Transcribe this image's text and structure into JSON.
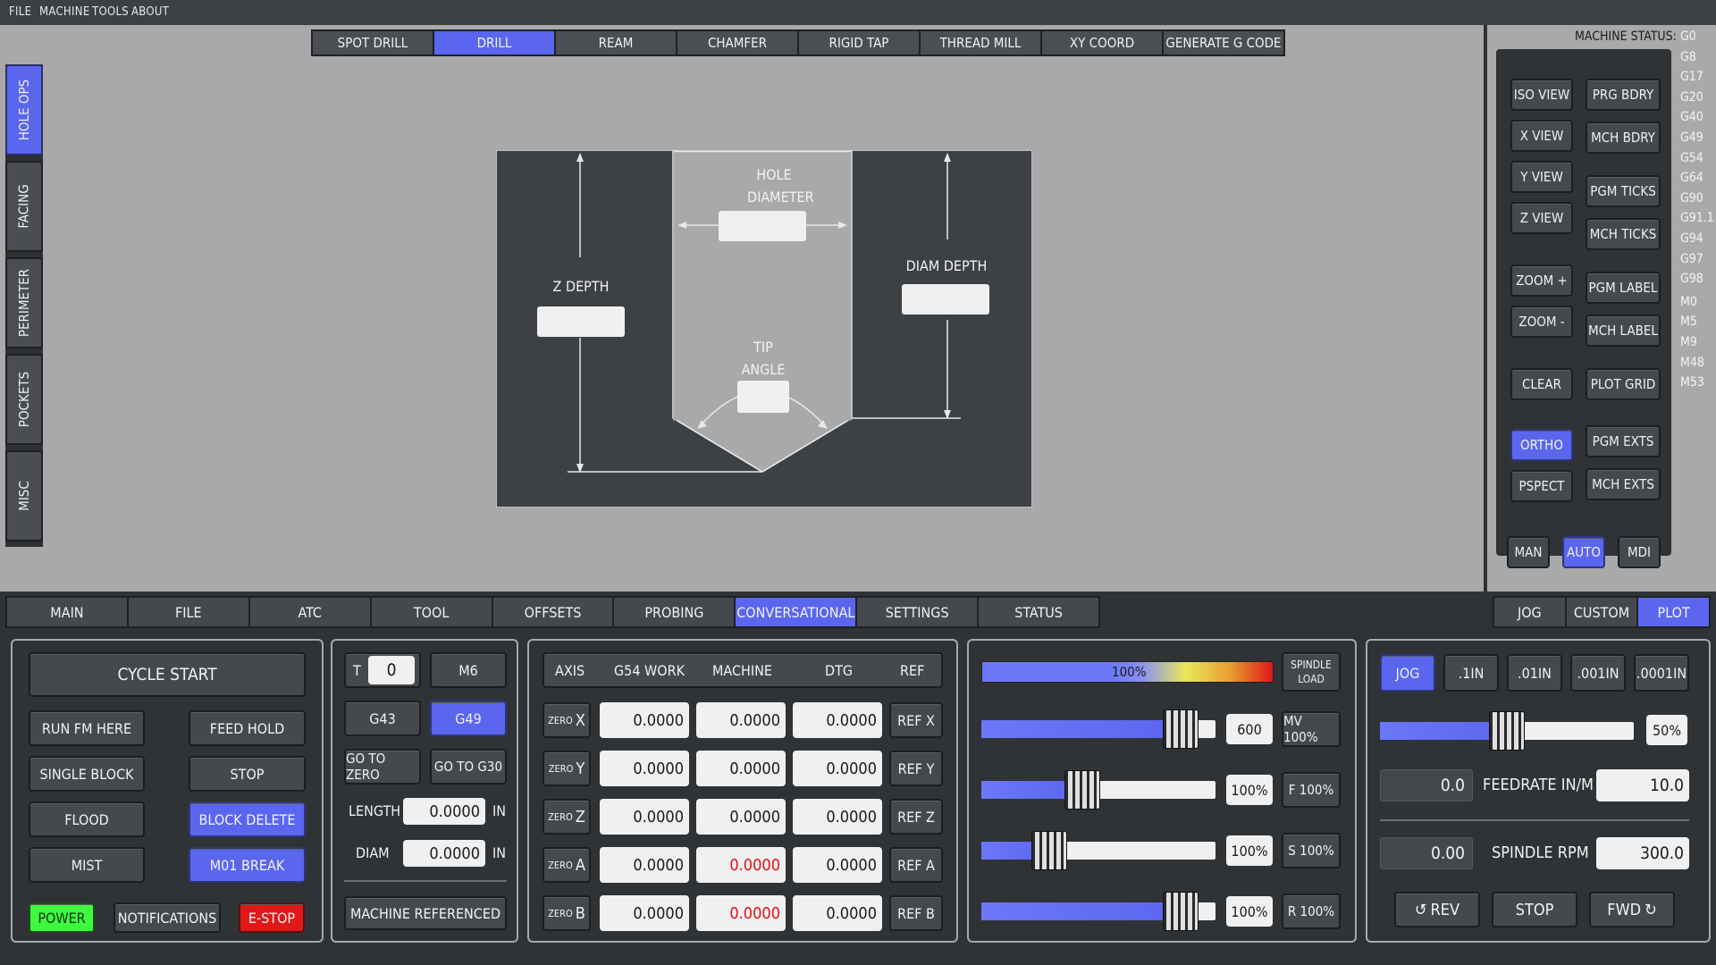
{
  "menu": [
    "FILE",
    "MACHINE",
    "TOOLS",
    "ABOUT"
  ],
  "side_tabs": [
    {
      "label": "HOLE OPS",
      "active": true
    },
    {
      "label": "FACING",
      "active": false
    },
    {
      "label": "PERIMETER",
      "active": false
    },
    {
      "label": "POCKETS",
      "active": false
    },
    {
      "label": "MISC",
      "active": false
    }
  ],
  "conv_tabs": [
    {
      "label": "SPOT DRILL",
      "active": false
    },
    {
      "label": "DRILL",
      "active": true
    },
    {
      "label": "REAM",
      "active": false
    },
    {
      "label": "CHAMFER",
      "active": false
    },
    {
      "label": "RIGID TAP",
      "active": false
    },
    {
      "label": "THREAD MILL",
      "active": false
    },
    {
      "label": "XY COORD",
      "active": false
    },
    {
      "label": "GENERATE G CODE",
      "active": false
    }
  ],
  "diagram": {
    "hole_diameter": "HOLE DIAMETER",
    "hole_diameter_l1": "HOLE",
    "hole_diameter_l2": "DIAMETER",
    "z_depth": "Z DEPTH",
    "diam_depth": "DIAM DEPTH",
    "tip_angle_l1": "TIP",
    "tip_angle_l2": "ANGLE"
  },
  "machine_status": {
    "title": "MACHINE STATUS:",
    "gcodes": [
      "G0",
      "G8",
      "G17",
      "G20",
      "G40",
      "G49",
      "G54",
      "G64",
      "G90",
      "G91.1",
      "G94",
      "G97",
      "G98",
      "M0",
      "M5",
      "M9",
      "M48",
      "M53"
    ]
  },
  "view_buttons": {
    "iso_view": "ISO VIEW",
    "x_view": "X VIEW",
    "y_view": "Y VIEW",
    "z_view": "Z VIEW",
    "zoom_in": "ZOOM +",
    "zoom_out": "ZOOM -",
    "clear": "CLEAR",
    "ortho": "ORTHO",
    "pspect": "PSPECT",
    "prg_bdry": "PRG BDRY",
    "mch_bdry": "MCH BDRY",
    "pgm_ticks": "PGM TICKS",
    "mch_ticks": "MCH TICKS",
    "pgm_label": "PGM LABEL",
    "mch_label": "MCH LABEL",
    "plot_grid": "PLOT GRID",
    "pgm_exts": "PGM EXTS",
    "mch_exts": "MCH EXTS",
    "man": "MAN",
    "auto": "AUTO",
    "mdi": "MDI"
  },
  "bottom_tabs": [
    {
      "label": "MAIN",
      "active": false
    },
    {
      "label": "FILE",
      "active": false
    },
    {
      "label": "ATC",
      "active": false
    },
    {
      "label": "TOOL",
      "active": false
    },
    {
      "label": "OFFSETS",
      "active": false
    },
    {
      "label": "PROBING",
      "active": false
    },
    {
      "label": "CONVERSATIONAL",
      "active": true
    },
    {
      "label": "SETTINGS",
      "active": false
    },
    {
      "label": "STATUS",
      "active": false
    }
  ],
  "right_tabs": [
    {
      "label": "JOG",
      "active": false
    },
    {
      "label": "CUSTOM",
      "active": false
    },
    {
      "label": "PLOT",
      "active": true
    }
  ],
  "controls": {
    "cycle_start": "CYCLE START",
    "run_fm_here": "RUN FM HERE",
    "feed_hold": "FEED HOLD",
    "single_block": "SINGLE BLOCK",
    "stop": "STOP",
    "flood": "FLOOD",
    "block_delete": "BLOCK DELETE",
    "mist": "MIST",
    "m01_break": "M01 BREAK",
    "power": "POWER",
    "notifications": "NOTIFICATIONS",
    "estop": "E-STOP"
  },
  "tool": {
    "t_label": "T",
    "t_value": "0",
    "m6": "M6",
    "g43": "G43",
    "g49": "G49",
    "go_to_zero": "GO TO ZERO",
    "go_to_g30": "GO TO G30",
    "length_label": "LENGTH",
    "length_value": "0.0000",
    "length_unit": "IN",
    "diam_label": "DIAM",
    "diam_value": "0.0000",
    "diam_unit": "IN",
    "machine_referenced": "MACHINE REFERENCED"
  },
  "dro": {
    "headers": [
      "AXIS",
      "G54 WORK",
      "MACHINE",
      "DTG",
      "REF"
    ],
    "zero_label": "ZERO",
    "rows": [
      {
        "axis": "X",
        "work": "0.0000",
        "machine": "0.0000",
        "dtg": "0.0000",
        "ref": "REF X",
        "machine_red": false
      },
      {
        "axis": "Y",
        "work": "0.0000",
        "machine": "0.0000",
        "dtg": "0.0000",
        "ref": "REF Y",
        "machine_red": false
      },
      {
        "axis": "Z",
        "work": "0.0000",
        "machine": "0.0000",
        "dtg": "0.0000",
        "ref": "REF Z",
        "machine_red": false
      },
      {
        "axis": "A",
        "work": "0.0000",
        "machine": "0.0000",
        "dtg": "0.0000",
        "ref": "REF A",
        "machine_red": true
      },
      {
        "axis": "B",
        "work": "0.0000",
        "machine": "0.0000",
        "dtg": "0.0000",
        "ref": "REF B",
        "machine_red": true
      }
    ]
  },
  "overrides": {
    "spindle_load_pct": "100%",
    "spindle_load_label_1": "SPINDLE",
    "spindle_load_label_2": "LOAD",
    "rows": [
      {
        "value": "600",
        "button": "MV 100%",
        "level": 0.85
      },
      {
        "value": "100%",
        "button": "F 100%",
        "level": 0.43
      },
      {
        "value": "100%",
        "button": "S 100%",
        "level": 0.29
      },
      {
        "value": "100%",
        "button": "R 100%",
        "level": 0.85
      }
    ]
  },
  "jog": {
    "modes": [
      {
        "label": "JOG",
        "active": true
      },
      {
        "label": ".1IN",
        "active": false
      },
      {
        "label": ".01IN",
        "active": false
      },
      {
        "label": ".001IN",
        "active": false
      },
      {
        "label": ".0001IN",
        "active": false
      }
    ],
    "jog_pct": "50%",
    "jog_level": 0.5,
    "feed_actual": "0.0",
    "feed_label": "FEEDRATE IN/M",
    "feed_set": "10.0",
    "rpm_actual": "0.00",
    "rpm_label": "SPINDLE RPM",
    "rpm_set": "300.0",
    "rev": "REV",
    "stop": "STOP",
    "fwd": "FWD"
  }
}
